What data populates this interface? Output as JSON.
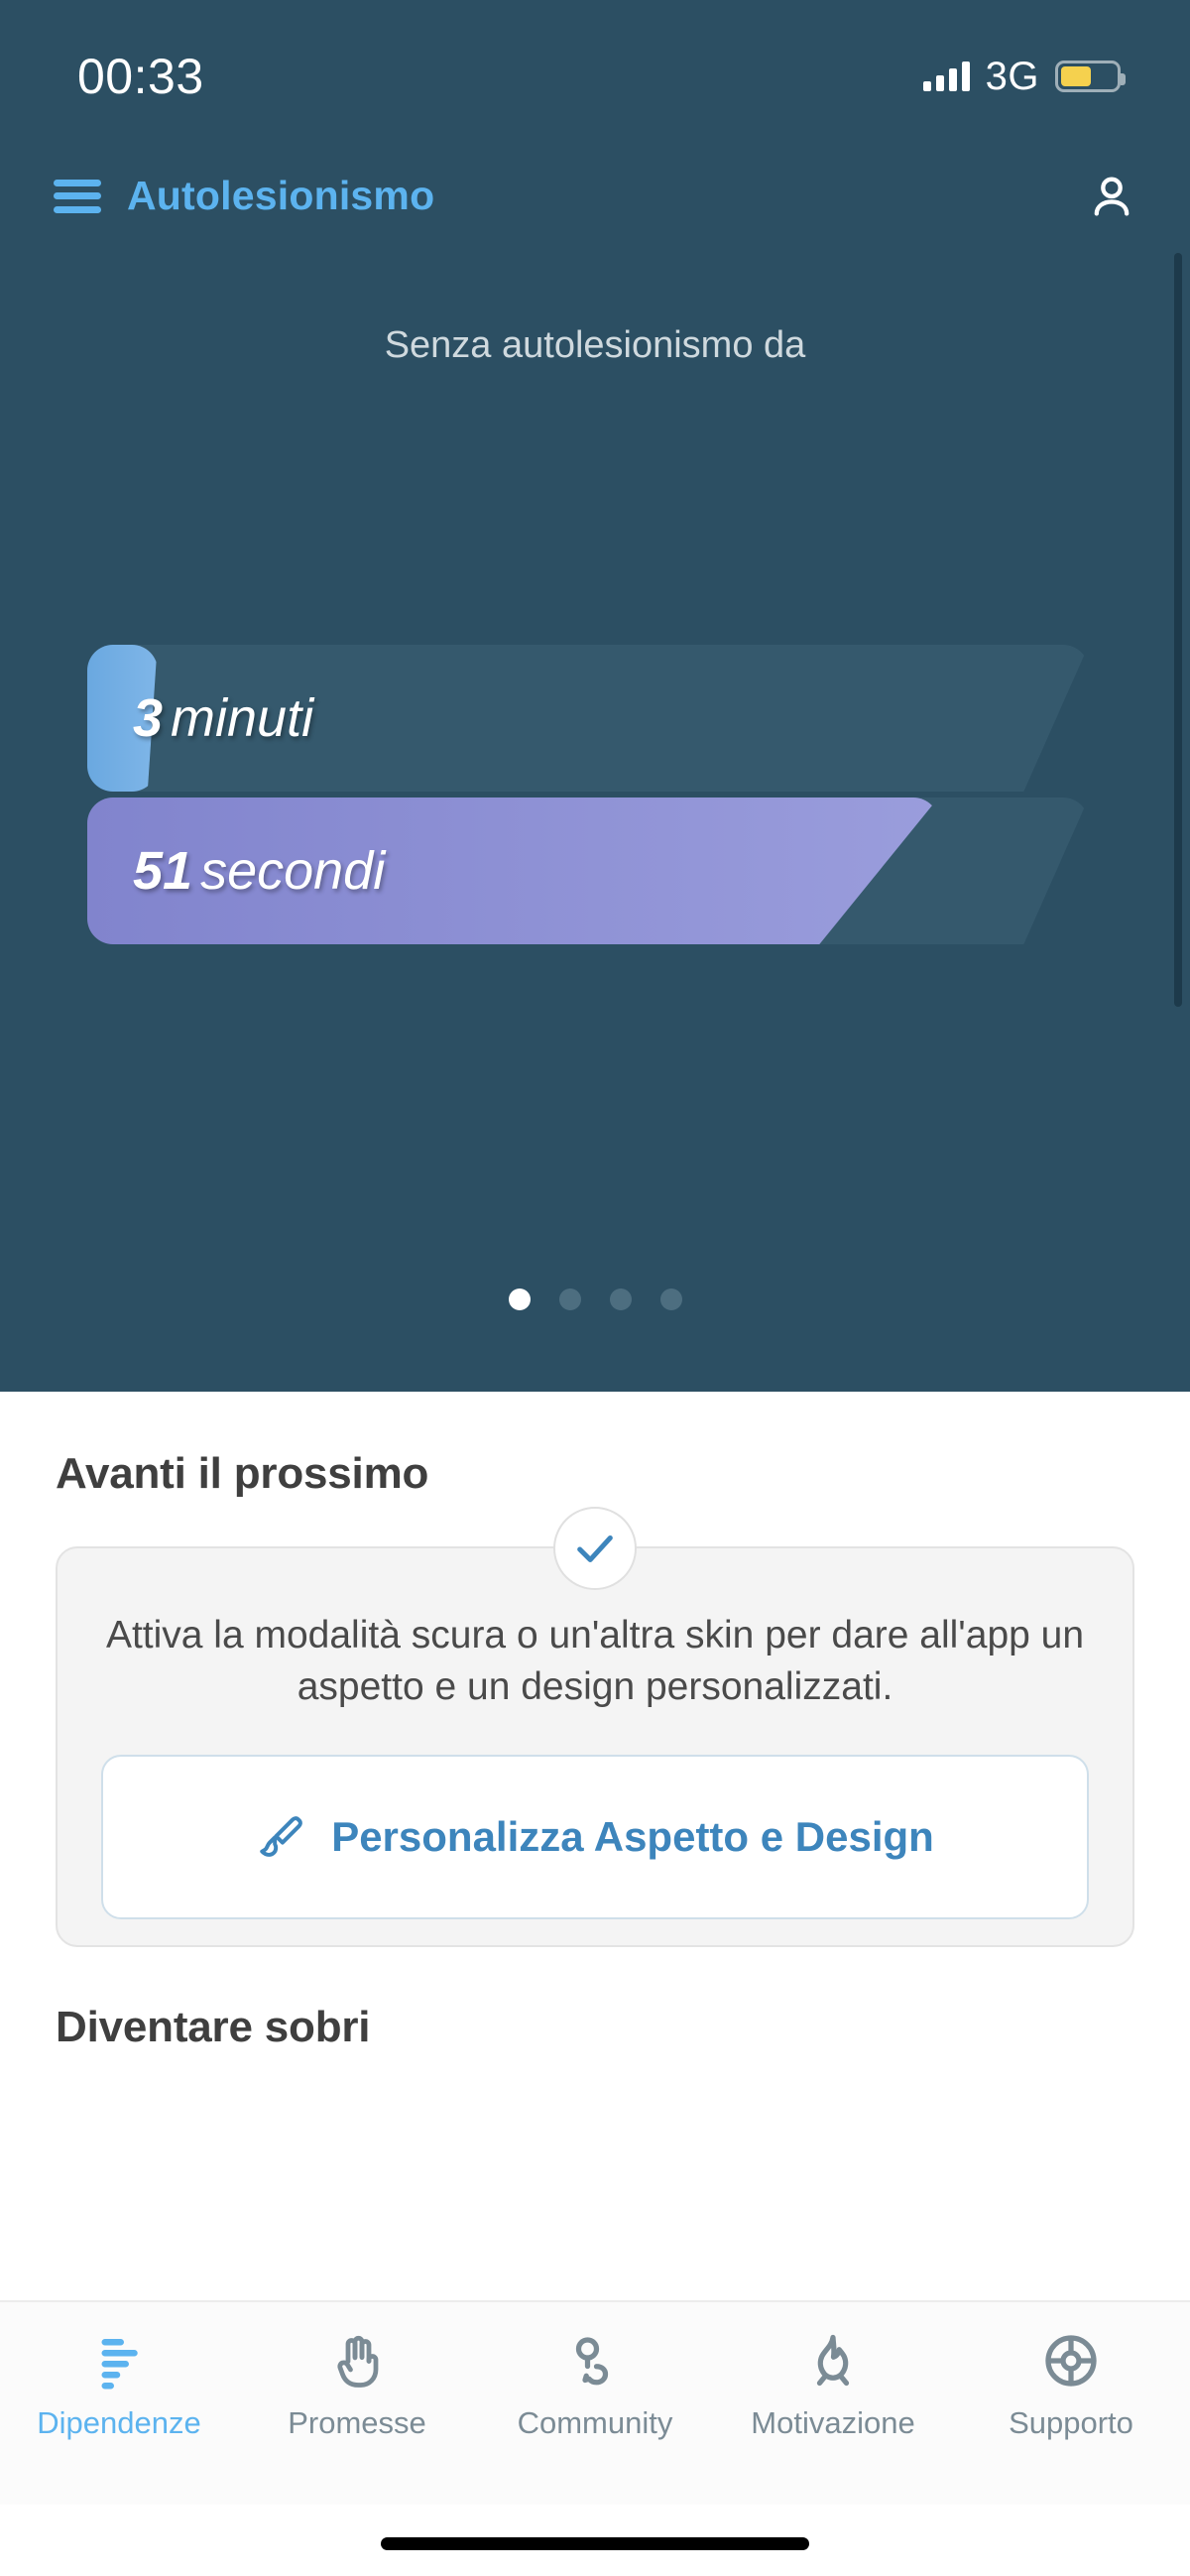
{
  "status_bar": {
    "time": "00:33",
    "network": "3G",
    "signal_icon": "signal-bars-icon",
    "battery_icon": "battery-low-power-icon",
    "battery_level_percent": 55,
    "battery_color": "#f5d14e"
  },
  "app_bar": {
    "menu_icon": "hamburger-menu-icon",
    "title": "Autolesionismo",
    "account_icon": "user-account-icon",
    "accent_color": "#5cb3ef",
    "background_color": "#2c4f63"
  },
  "hero": {
    "subtitle": "Senza autolesionismo da",
    "counters": [
      {
        "value": "3",
        "unit": "minuti",
        "fill_percent": 7,
        "color": "#6aa8e0"
      },
      {
        "value": "51",
        "unit": "secondi",
        "fill_percent": 85,
        "color": "#8184cd"
      }
    ],
    "pager": {
      "total": 4,
      "active_index": 0
    }
  },
  "main": {
    "section_next_title": "Avanti il prossimo",
    "card": {
      "status_icon": "checkmark-icon",
      "body": "Attiva la modalità scura o un'altra skin per dare all'app un aspetto e un design personalizzati.",
      "action_icon": "paintbrush-icon",
      "action_label": "Personalizza Aspetto e Design",
      "action_color": "#3d85bc"
    },
    "section_sober_title": "Diventare sobri"
  },
  "tab_bar": {
    "active_index": 0,
    "active_color": "#5cb3ef",
    "inactive_color": "#7b8b95",
    "items": [
      {
        "label": "Dipendenze",
        "icon": "bar-chart-icon"
      },
      {
        "label": "Promesse",
        "icon": "hand-raised-icon"
      },
      {
        "label": "Community",
        "icon": "chat-bubbles-icon"
      },
      {
        "label": "Motivazione",
        "icon": "flame-icon"
      },
      {
        "label": "Supporto",
        "icon": "life-ring-icon"
      }
    ]
  },
  "system": {
    "home_indicator": "home-indicator-bar"
  }
}
